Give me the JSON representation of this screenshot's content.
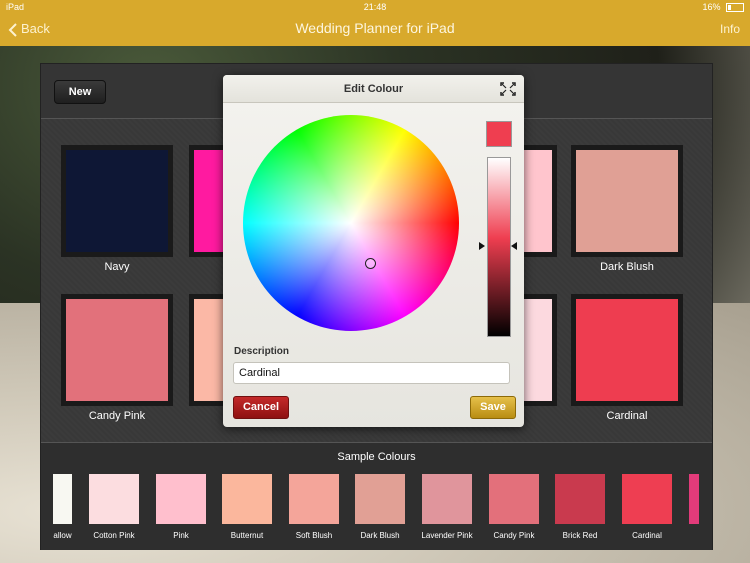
{
  "status_bar": {
    "device": "iPad",
    "time": "21:48",
    "battery": "16%"
  },
  "nav": {
    "back_label": "Back",
    "title": "Wedding Planner for iPad",
    "info_label": "Info"
  },
  "toolbar": {
    "new_label": "New"
  },
  "swatches": [
    {
      "label": "Navy",
      "color": "#0e1735"
    },
    {
      "label": "",
      "color": "#ff1aa0"
    },
    {
      "label": "",
      "color": "#ffc5cd"
    },
    {
      "label": "Dark Blush",
      "color": "#e0a095"
    },
    {
      "label": "Candy Pink",
      "color": "#e2717b"
    },
    {
      "label": "",
      "color": "#fbb8a6"
    },
    {
      "label": "",
      "color": "#fcd9df"
    },
    {
      "label": "Cardinal",
      "color": "#ee3d50"
    }
  ],
  "sample_colours": {
    "title": "Sample Colours",
    "items": [
      {
        "label": "allow",
        "color": "#f8f8f2"
      },
      {
        "label": "Cotton Pink",
        "color": "#fcdde0"
      },
      {
        "label": "Pink",
        "color": "#ffbfcd"
      },
      {
        "label": "Butternut",
        "color": "#fbb79d"
      },
      {
        "label": "Soft Blush",
        "color": "#f4a59a"
      },
      {
        "label": "Dark Blush",
        "color": "#e1a095"
      },
      {
        "label": "Lavender Pink",
        "color": "#e0959c"
      },
      {
        "label": "Candy Pink",
        "color": "#e3707b"
      },
      {
        "label": "Brick Red",
        "color": "#c93a4e"
      },
      {
        "label": "Cardinal",
        "color": "#ee3e52"
      },
      {
        "label": "",
        "color": "#e23b7a"
      }
    ]
  },
  "dialog": {
    "title": "Edit Colour",
    "current_color": "#ef3e50",
    "description_label": "Description",
    "description_value": "Cardinal",
    "cancel_label": "Cancel",
    "save_label": "Save"
  }
}
